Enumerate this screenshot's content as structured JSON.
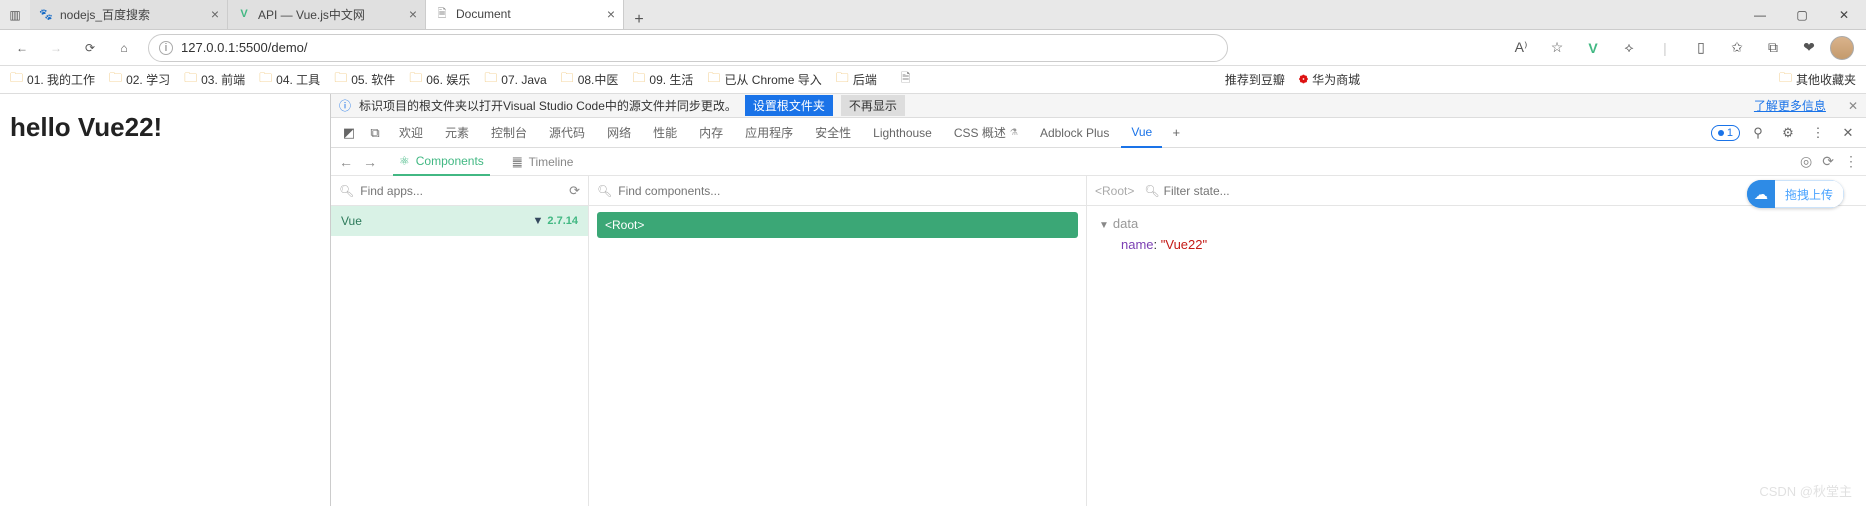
{
  "tabs": [
    {
      "title": "nodejs_百度搜索",
      "favicon": "🐾"
    },
    {
      "title": "API — Vue.js中文网",
      "favicon": "V"
    },
    {
      "title": "Document",
      "favicon": "🗎"
    }
  ],
  "address": {
    "url": "127.0.0.1:5500/demo/"
  },
  "bookmarks": [
    "01. 我的工作",
    "02. 学习",
    "03. 前端",
    "04. 工具",
    "05. 软件",
    "06. 娱乐",
    "07. Java",
    "08.中医",
    "09. 生活",
    "已从 Chrome 导入",
    "后端"
  ],
  "bookmarks_page": "推荐到豆瓣",
  "bookmarks_huawei": "华为商城",
  "bookmarks_other": "其他收藏夹",
  "page": {
    "heading": "hello Vue22!"
  },
  "infobar": {
    "text": "标识项目的根文件夹以打开Visual Studio Code中的源文件并同步更改。",
    "btn1": "设置根文件夹",
    "btn2": "不再显示",
    "link": "了解更多信息"
  },
  "devtabs": [
    "欢迎",
    "元素",
    "控制台",
    "源代码",
    "网络",
    "性能",
    "内存",
    "应用程序",
    "安全性",
    "Lighthouse"
  ],
  "devtabs_css": "CSS 概述",
  "devtabs_adblock": "Adblock Plus",
  "devtabs_vue": "Vue",
  "badge_count": "1",
  "vue_sub": {
    "components": "Components",
    "timeline": "Timeline"
  },
  "col1": {
    "placeholder": "Find apps...",
    "app": "Vue",
    "version": "2.7.14"
  },
  "col2": {
    "placeholder": "Find components...",
    "root": "<Root>"
  },
  "col3": {
    "root": "<Root>",
    "placeholder": "Filter state...",
    "section": "data",
    "key": "name",
    "value": "\"Vue22\""
  },
  "float": "拖拽上传",
  "watermark": "CSDN @秋堂主"
}
